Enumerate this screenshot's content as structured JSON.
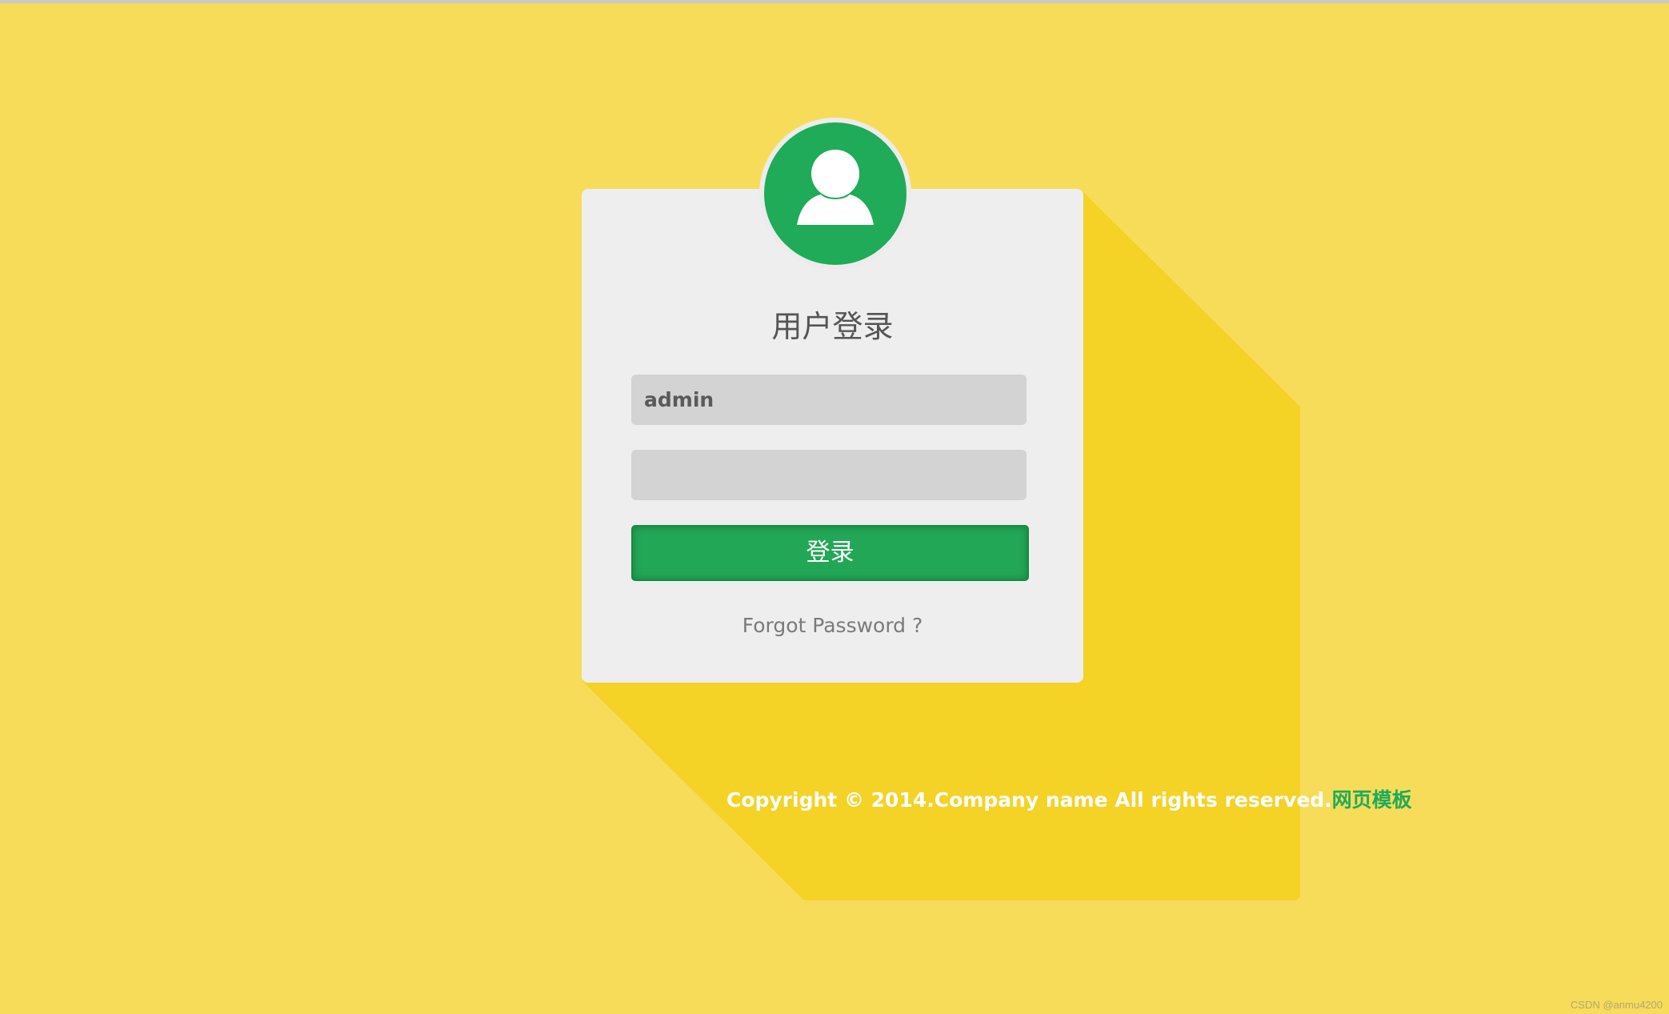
{
  "colors": {
    "background": "#f7dc5a",
    "shadow": "#f4d226",
    "card": "#eeeeee",
    "accent": "#1fab58",
    "input_bg": "#d3d3d3"
  },
  "avatar": {
    "icon": "user-icon"
  },
  "login": {
    "title": "用户登录",
    "username_value": "admin",
    "password_value": "",
    "submit_label": "登录",
    "forgot_label": "Forgot Password ?"
  },
  "footer": {
    "copyright": "Copyright © 2014.Company name All rights reserved.",
    "link_label": "网页模板"
  },
  "watermark": "CSDN @anmu4200"
}
